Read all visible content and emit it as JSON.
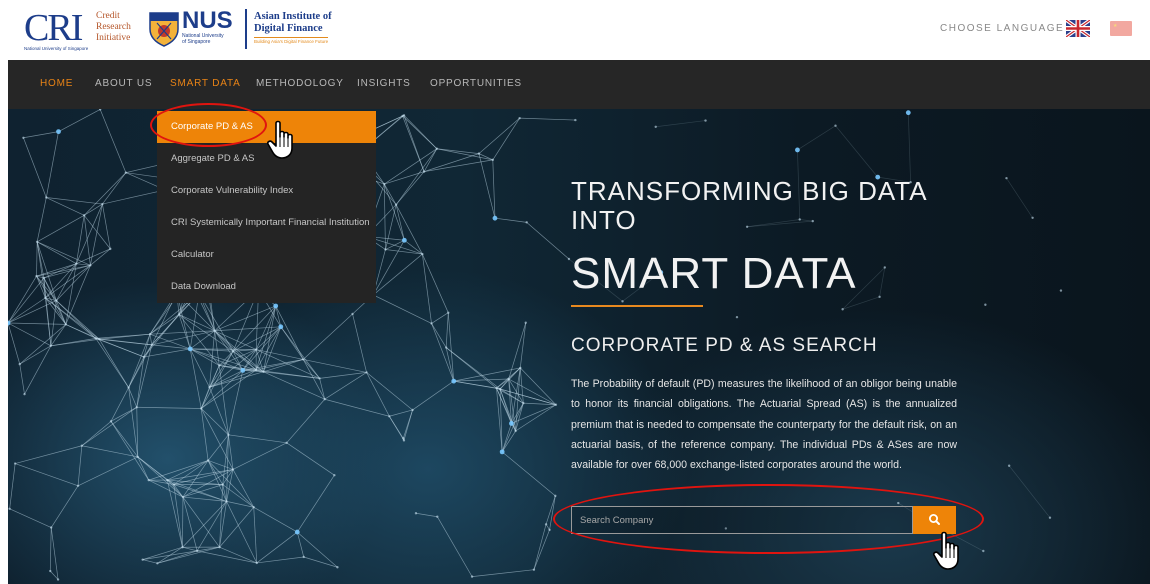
{
  "header": {
    "cri_logo": {
      "letters": "CRI",
      "lines": [
        "Credit",
        "Research",
        "Initiative"
      ],
      "tagline": "National University of Singapore"
    },
    "nus_logo": {
      "word": "NUS",
      "sub": [
        "National University",
        "of Singapore"
      ]
    },
    "aidf_logo": {
      "lines": [
        "Asian Institute of",
        "Digital Finance"
      ],
      "tagline": "Building Asia's Digital Finance Future"
    },
    "language_label": "CHOOSE LANGUAGE",
    "flags": [
      "uk-flag-icon",
      "china-flag-icon"
    ]
  },
  "nav": {
    "items": [
      {
        "label": "HOME",
        "active": true
      },
      {
        "label": "ABOUT US"
      },
      {
        "label": "SMART DATA"
      },
      {
        "label": "METHODOLOGY"
      },
      {
        "label": "INSIGHTS"
      },
      {
        "label": "OPPORTUNITIES"
      }
    ]
  },
  "dropdown": {
    "items": [
      {
        "label": "Corporate PD & AS",
        "active": true
      },
      {
        "label": "Aggregate PD & AS"
      },
      {
        "label": "Corporate Vulnerability Index"
      },
      {
        "label": "CRI Systemically Important Financial Institution"
      },
      {
        "label": "Calculator"
      },
      {
        "label": "Data Download"
      }
    ]
  },
  "hero": {
    "line1": "TRANSFORMING BIG DATA",
    "line2": "INTO",
    "big": "SMART DATA",
    "search_title": "CORPORATE PD & AS SEARCH",
    "description": "The Probability of default (PD) measures the likelihood of an obligor being unable to honor its financial obligations. The Actuarial Spread (AS) is the annualized premium that is needed to compensate the counterparty for the default risk, on an actuarial basis, of the reference company. The individual PDs & ASes are now available for over 68,000 exchange-listed corporates around the world."
  },
  "search": {
    "placeholder": "Search Company",
    "value": "",
    "button_icon": "search-icon"
  },
  "colors": {
    "accent": "#ee8408",
    "nav_bg": "#262626",
    "annotation": "#e0140f"
  }
}
